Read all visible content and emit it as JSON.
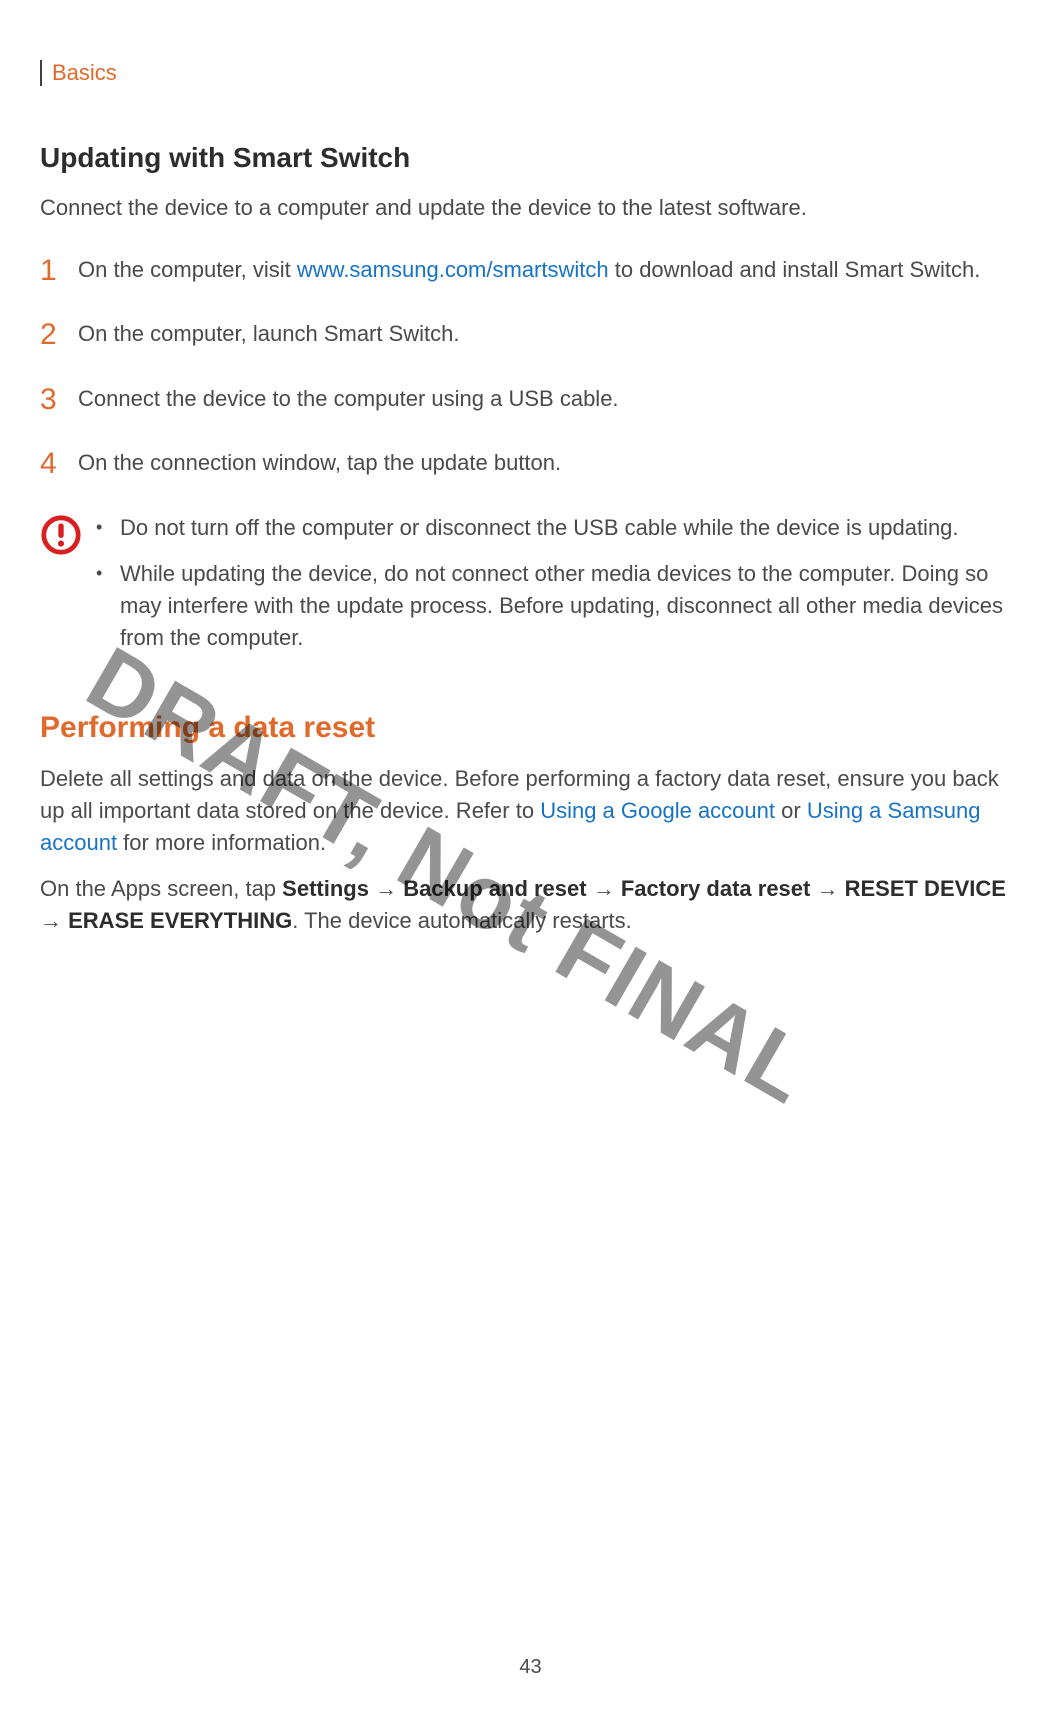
{
  "header": {
    "section": "Basics"
  },
  "sec1": {
    "heading": "Updating with Smart Switch",
    "intro_a": "Connect the device to a computer and update the device to the latest software.",
    "steps": [
      {
        "num": "1",
        "pre": "On the computer, visit ",
        "link": "www.samsung.com/smartswitch",
        "post": " to download and install Smart Switch."
      },
      {
        "num": "2",
        "text": "On the computer, launch Smart Switch."
      },
      {
        "num": "3",
        "text": "Connect the device to the computer using a USB cable."
      },
      {
        "num": "4",
        "text": "On the connection window, tap the update button."
      }
    ],
    "caution": [
      "Do not turn off the computer or disconnect the USB cable while the device is updating.",
      "While updating the device, do not connect other media devices to the computer. Doing so may interfere with the update process. Before updating, disconnect all other media devices from the computer."
    ]
  },
  "sec2": {
    "heading": "Performing a data reset",
    "p1_a": "Delete all settings and data on the device. Before performing a factory data reset, ensure you back up all important data stored on the device. Refer to ",
    "p1_link1": "Using a Google account",
    "p1_b": " or ",
    "p1_link2": "Using a Samsung account",
    "p1_c": " for more information.",
    "p2_a": "On the Apps screen, tap ",
    "p2_b1": "Settings",
    "p2_arr1": " → ",
    "p2_b2": "Backup and reset",
    "p2_arr2": " → ",
    "p2_b3": "Factory data reset",
    "p2_arr3": " → ",
    "p2_b4": "RESET DEVICE",
    "p2_arr4": " → ",
    "p2_b5": "ERASE EVERYTHING",
    "p2_c": ". The device automatically restarts."
  },
  "watermark": "DRAFT, Not FINAL",
  "page_number": "43"
}
